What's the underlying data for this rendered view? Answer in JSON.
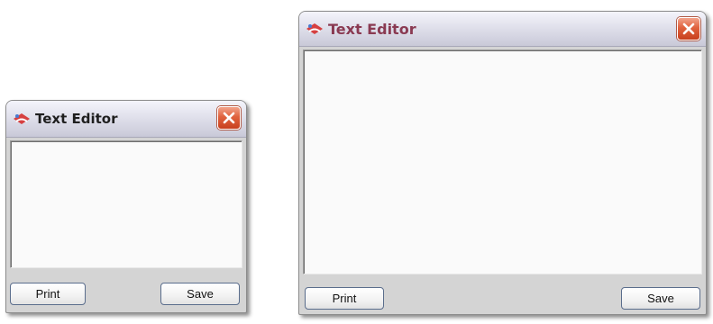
{
  "windows": [
    {
      "title": "Text Editor",
      "editor_text": "",
      "buttons": {
        "print": "Print",
        "save": "Save"
      }
    },
    {
      "title": "Text Editor",
      "editor_text": "",
      "buttons": {
        "print": "Print",
        "save": "Save"
      }
    }
  ],
  "icons": {
    "app": "app-icon",
    "close": "close-icon"
  },
  "colors": {
    "title_small": "#1f1f1f",
    "title_large": "#8a3a52",
    "close_button": "#e0623e",
    "window_body": "#d4d4d4",
    "editor_background": "#fafafa"
  }
}
